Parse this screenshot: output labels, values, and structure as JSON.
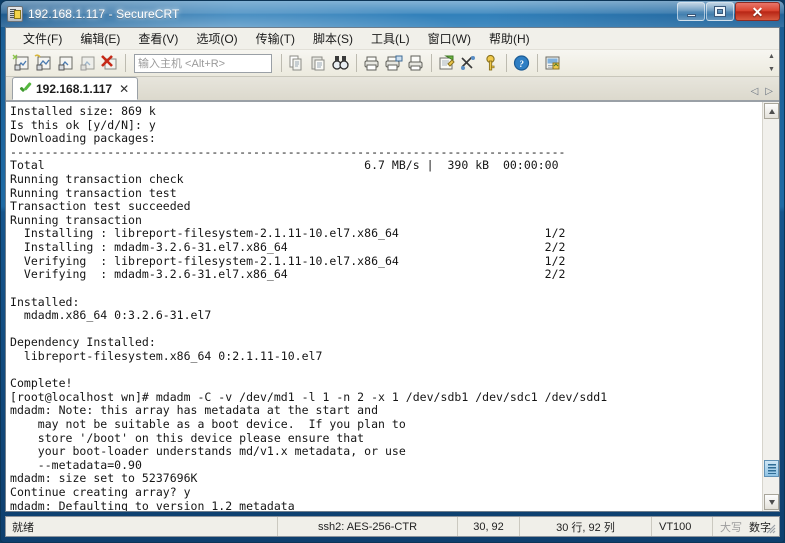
{
  "window": {
    "title": "192.168.1.117 - SecureCRT",
    "app_icon": "securecrt-icon",
    "minimize_label": "",
    "maximize_label": "",
    "close_label": "✕"
  },
  "menubar": {
    "items": [
      {
        "label": "文件(F)",
        "name": "menu-file"
      },
      {
        "label": "编辑(E)",
        "name": "menu-edit"
      },
      {
        "label": "查看(V)",
        "name": "menu-view"
      },
      {
        "label": "选项(O)",
        "name": "menu-options"
      },
      {
        "label": "传输(T)",
        "name": "menu-transfer"
      },
      {
        "label": "脚本(S)",
        "name": "menu-script"
      },
      {
        "label": "工具(L)",
        "name": "menu-tools"
      },
      {
        "label": "窗口(W)",
        "name": "menu-window"
      },
      {
        "label": "帮助(H)",
        "name": "menu-help"
      }
    ]
  },
  "toolbar": {
    "host_placeholder": "输入主机 <Alt+R>",
    "host_value": "",
    "icons": [
      "new-session-icon",
      "clone-session-icon",
      "copy-session-icon",
      "reconnect-icon",
      "disconnect-icon",
      "copy-icon",
      "paste-icon",
      "find-icon",
      "print-icon",
      "print-screen-icon",
      "print-selection-icon",
      "log-session-icon",
      "session-options-icon",
      "key-icon",
      "help-icon",
      "chat-window-icon"
    ]
  },
  "tabbar": {
    "tabs": [
      {
        "label": "192.168.1.117",
        "connected": true,
        "close": "✕"
      }
    ],
    "nav_prev": "◁",
    "nav_next": "▷"
  },
  "terminal": {
    "lines": [
      "Installed size: 869 k",
      "Is this ok [y/d/N]: y",
      "Downloading packages:",
      "--------------------------------------------------------------------------------",
      "Total                                              6.7 MB/s |  390 kB  00:00:00",
      "Running transaction check",
      "Running transaction test",
      "Transaction test succeeded",
      "Running transaction",
      "  Installing : libreport-filesystem-2.1.11-10.el7.x86_64                     1/2",
      "  Installing : mdadm-3.2.6-31.el7.x86_64                                     2/2",
      "  Verifying  : libreport-filesystem-2.1.11-10.el7.x86_64                     1/2",
      "  Verifying  : mdadm-3.2.6-31.el7.x86_64                                     2/2",
      "",
      "Installed:",
      "  mdadm.x86_64 0:3.2.6-31.el7",
      "",
      "Dependency Installed:",
      "  libreport-filesystem.x86_64 0:2.1.11-10.el7",
      "",
      "Complete!",
      "[root@localhost wn]# mdadm -C -v /dev/md1 -l 1 -n 2 -x 1 /dev/sdb1 /dev/sdc1 /dev/sdd1",
      "mdadm: Note: this array has metadata at the start and",
      "    may not be suitable as a boot device.  If you plan to",
      "    store '/boot' on this device please ensure that",
      "    your boot-loader understands md/v1.x metadata, or use",
      "    --metadata=0.90",
      "mdadm: size set to 5237696K",
      "Continue creating array? y",
      "mdadm: Defaulting to version 1.2 metadata"
    ]
  },
  "statusbar": {
    "ready": "就绪",
    "encryption": "ssh2: AES-256-CTR",
    "cursor_position": "30, 92",
    "dimensions": "30 行, 92 列",
    "emulation": "VT100",
    "caps": "大写",
    "num": "数字"
  }
}
